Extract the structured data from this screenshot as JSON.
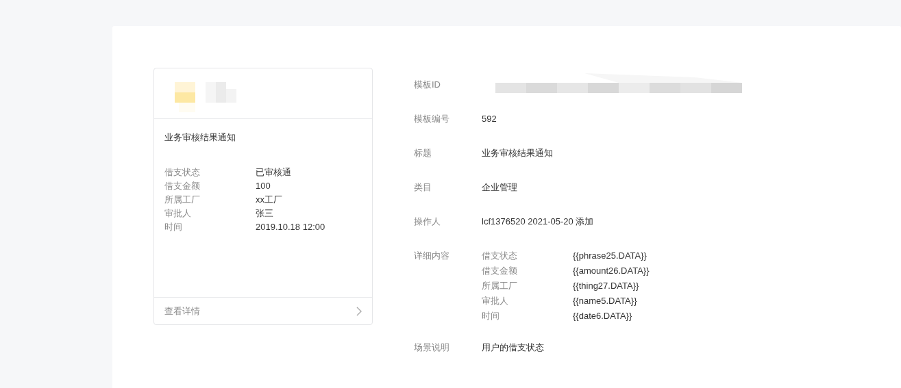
{
  "preview_card": {
    "title": "业务审核结果通知",
    "fields": [
      {
        "label": "借支状态",
        "value": "已审核通"
      },
      {
        "label": "借支金额",
        "value": "100"
      },
      {
        "label": "所属工厂",
        "value": "xx工厂"
      },
      {
        "label": "审批人",
        "value": "张三"
      },
      {
        "label": "时间",
        "value": "2019.10.18 12:00"
      }
    ],
    "footer_link": "查看详情"
  },
  "details": [
    {
      "label": "模板ID",
      "kind": "redacted"
    },
    {
      "label": "模板编号",
      "kind": "text",
      "value": "592"
    },
    {
      "label": "标题",
      "kind": "text",
      "value": "业务审核结果通知"
    },
    {
      "label": "类目",
      "kind": "text",
      "value": "企业管理"
    },
    {
      "label": "操作人",
      "kind": "text",
      "value": "lcf1376520 2021-05-20 添加"
    },
    {
      "label": "详细内容",
      "kind": "fields",
      "fields": [
        {
          "label": "借支状态",
          "value": "{{phrase25.DATA}}"
        },
        {
          "label": "借支金额",
          "value": "{{amount26.DATA}}"
        },
        {
          "label": "所属工厂",
          "value": "{{thing27.DATA}}"
        },
        {
          "label": "审批人",
          "value": "{{name5.DATA}}"
        },
        {
          "label": "时间",
          "value": "{{date6.DATA}}"
        }
      ]
    },
    {
      "label": "场景说明",
      "kind": "text",
      "value": "用户的借支状态"
    }
  ]
}
